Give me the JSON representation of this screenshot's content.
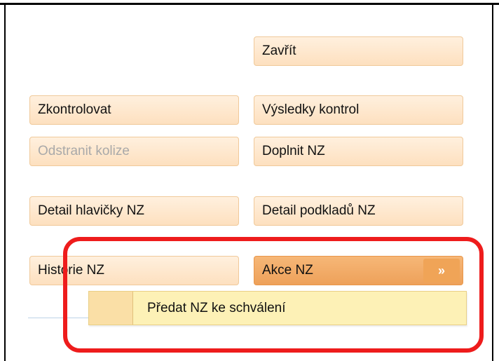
{
  "buttons": {
    "close": "Zavřít",
    "check": "Zkontrolovat",
    "check_results": "Výsledky kontrol",
    "remove_collisions": "Odstranit kolize",
    "complete_nz": "Doplnit NZ",
    "header_detail": "Detail hlavičky NZ",
    "documents_detail": "Detail podkladů NZ",
    "history": "Historie NZ",
    "actions": "Akce NZ"
  },
  "actions_chevron": "»",
  "dropdown": {
    "items": [
      {
        "label": "Předat NZ ke schválení"
      }
    ]
  },
  "colors": {
    "button_bg": "#fde6c9",
    "button_active_bg": "#f3ac66",
    "dropdown_bg": "#fdf1b6",
    "highlight": "#ee1c1c"
  }
}
